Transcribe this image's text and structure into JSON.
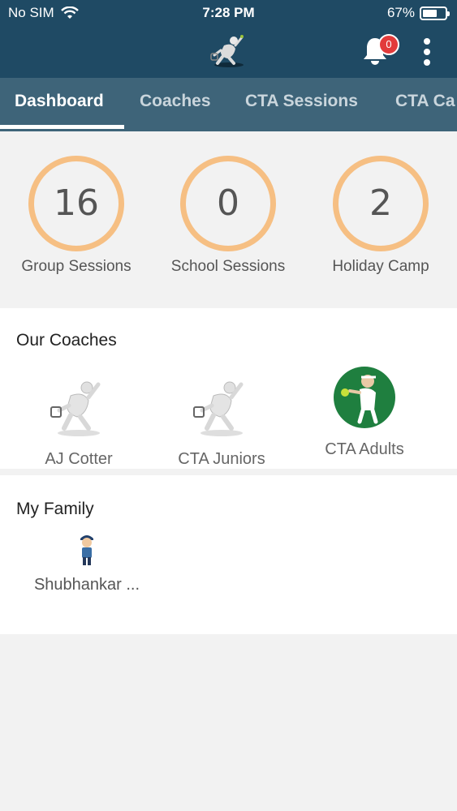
{
  "status_bar": {
    "carrier": "No SIM",
    "time": "7:28 PM",
    "battery": "67%",
    "battery_level": 0.67
  },
  "header": {
    "logo_icon": "tennis-player-logo-icon",
    "notifications_count": "0"
  },
  "tabs": [
    {
      "label": "Dashboard",
      "active": true
    },
    {
      "label": "Coaches"
    },
    {
      "label": "CTA Sessions"
    },
    {
      "label": "CTA Ca"
    }
  ],
  "stats": [
    {
      "value": "16",
      "label": "Group Sessions"
    },
    {
      "value": "0",
      "label": "School Sessions"
    },
    {
      "value": "2",
      "label": "Holiday Camp"
    }
  ],
  "coaches": {
    "title": "Our Coaches",
    "items": [
      {
        "name": "AJ Cotter",
        "icon": "tennis-player-icon"
      },
      {
        "name": "CTA Juniors",
        "icon": "tennis-player-icon"
      },
      {
        "name": "CTA Adults",
        "icon": "tennis-adult-avatar-icon"
      }
    ]
  },
  "family": {
    "title": "My Family",
    "members": [
      {
        "name": "Shubhankar ...",
        "icon": "child-avatar-icon"
      }
    ]
  },
  "colors": {
    "header": "#1f4a64",
    "tabbar": "#3e6479",
    "ring": "#f6bf83",
    "badge": "#e23b3b"
  }
}
